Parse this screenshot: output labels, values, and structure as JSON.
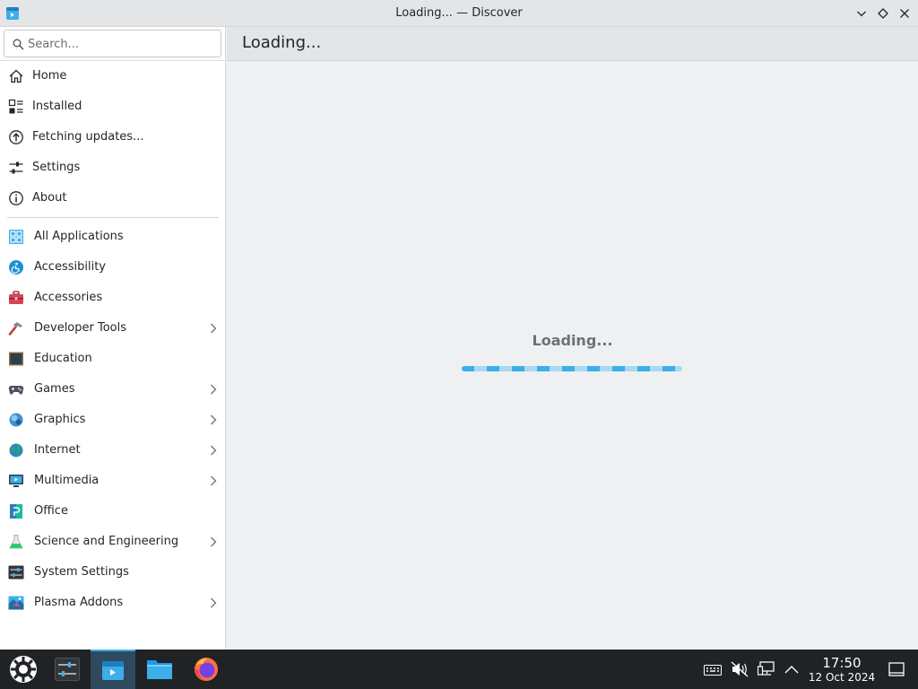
{
  "window": {
    "title": "Loading... — Discover"
  },
  "search": {
    "placeholder": "Search..."
  },
  "sidebar": {
    "nav": [
      {
        "label": "Home",
        "icon": "home-icon"
      },
      {
        "label": "Installed",
        "icon": "installed-icon"
      },
      {
        "label": "Fetching updates...",
        "icon": "update-icon"
      },
      {
        "label": "Settings",
        "icon": "settings-icon"
      },
      {
        "label": "About",
        "icon": "info-icon"
      }
    ],
    "categories": [
      {
        "label": "All Applications",
        "icon": "grid-icon",
        "has_children": false
      },
      {
        "label": "Accessibility",
        "icon": "accessibility-icon",
        "has_children": false
      },
      {
        "label": "Accessories",
        "icon": "toolbox-icon",
        "has_children": false
      },
      {
        "label": "Developer Tools",
        "icon": "hammer-icon",
        "has_children": true
      },
      {
        "label": "Education",
        "icon": "chalkboard-icon",
        "has_children": false
      },
      {
        "label": "Games",
        "icon": "gamepad-icon",
        "has_children": true
      },
      {
        "label": "Graphics",
        "icon": "graphics-icon",
        "has_children": true
      },
      {
        "label": "Internet",
        "icon": "globe-icon",
        "has_children": true
      },
      {
        "label": "Multimedia",
        "icon": "multimedia-icon",
        "has_children": true
      },
      {
        "label": "Office",
        "icon": "office-icon",
        "has_children": false
      },
      {
        "label": "Science and Engineering",
        "icon": "flask-icon",
        "has_children": true
      },
      {
        "label": "System Settings",
        "icon": "system-settings-icon",
        "has_children": false
      },
      {
        "label": "Plasma Addons",
        "icon": "plasma-addons-icon",
        "has_children": true
      }
    ]
  },
  "main": {
    "header_title": "Loading...",
    "status_text": "Loading..."
  },
  "taskbar": {
    "time": "17:50",
    "date": "12 Oct 2024"
  },
  "colors": {
    "accent": "#3daee9",
    "taskbar_bg": "#202326",
    "window_bg": "#eff0f1"
  }
}
